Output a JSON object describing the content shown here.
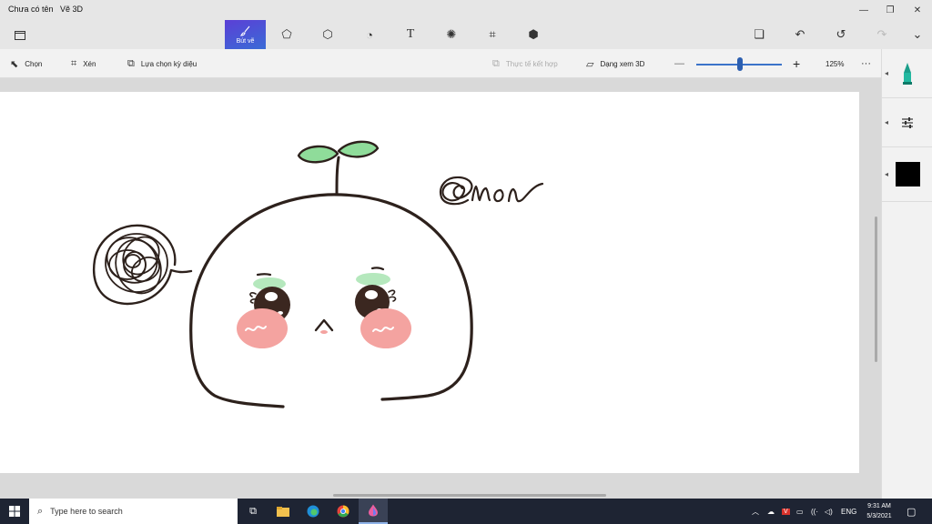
{
  "window": {
    "doc_title": "Chưa có tên",
    "app_name": "Vẽ 3D"
  },
  "ribbon": {
    "active_label": "Bút vẽ"
  },
  "toolbar": {
    "select_label": "Chọn",
    "crop_label": "Xén",
    "magic_select_label": "Lựa chọn kỳ diệu",
    "mixed_reality_label": "Thực tế kết hợp",
    "view3d_label": "Dạng xem 3D",
    "zoom_value": "125%"
  },
  "canvas": {
    "handwriting": "@mon"
  },
  "sidepanel": {
    "selected_color": "#000000"
  },
  "taskbar": {
    "search_placeholder": "Type here to search",
    "language": "ENG",
    "time": "9:31 AM",
    "date": "5/3/2021"
  },
  "colors": {
    "accent": "#4a5be0",
    "taskbar_bg": "#1e2433",
    "stroke": "#2d211c",
    "leaf": "#8fdc9a",
    "blush": "#f4a3a0"
  }
}
